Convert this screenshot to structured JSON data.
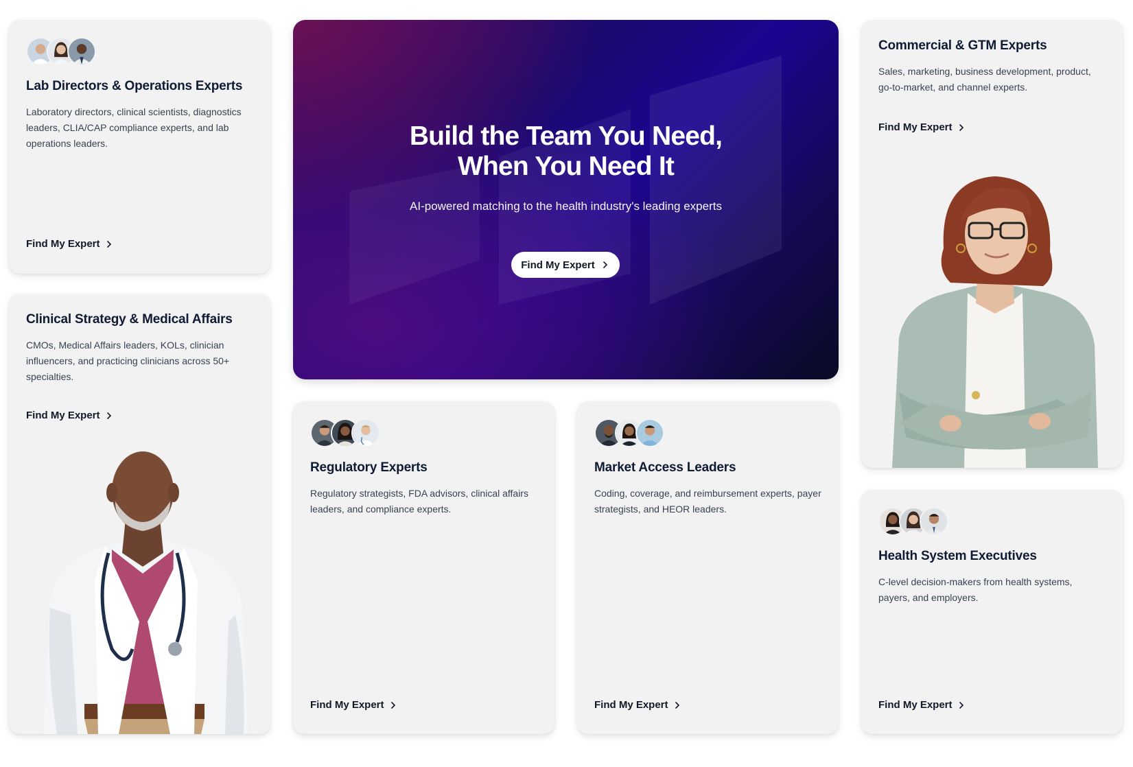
{
  "hero": {
    "title_line1": "Build the Team You Need,",
    "title_line2": "When You Need It",
    "subtitle": "AI-powered matching to the health industry's leading experts",
    "cta": "Find My Expert"
  },
  "cards": {
    "lab": {
      "title": "Lab Directors & Operations Experts",
      "desc": "Laboratory directors, clinical scientists, diagnostics leaders, CLIA/CAP compliance experts, and lab operations leaders.",
      "cta": "Find My Expert"
    },
    "clinical": {
      "title": "Clinical Strategy & Medical Affairs",
      "desc": "CMOs, Medical Affairs leaders, KOLs, clinician influencers, and practicing clinicians across 50+ specialties.",
      "cta": "Find My Expert"
    },
    "regulatory": {
      "title": "Regulatory Experts",
      "desc": "Regulatory strategists, FDA advisors, clinical affairs leaders, and compliance experts.",
      "cta": "Find My Expert"
    },
    "market": {
      "title": "Market Access Leaders",
      "desc": "Coding, coverage, and reimbursement experts, payer strategists, and HEOR leaders.",
      "cta": "Find My Expert"
    },
    "commercial": {
      "title": "Commercial & GTM Experts",
      "desc": "Sales, marketing, business development, product, go-to-market, and channel experts.",
      "cta": "Find My Expert"
    },
    "health": {
      "title": "Health System Executives",
      "desc": "C-level decision-makers from health systems, payers, and employers.",
      "cta": "Find My Expert"
    }
  },
  "colors": {
    "card_bg": "#f2f2f2",
    "title": "#0f1b33",
    "hero_accent": "#1b0590"
  }
}
